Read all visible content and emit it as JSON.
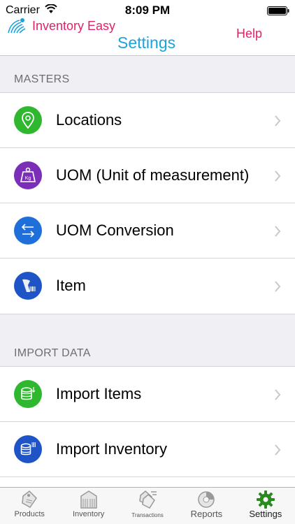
{
  "status_bar": {
    "carrier": "Carrier",
    "time": "8:09 PM"
  },
  "nav": {
    "app_name": "Inventory Easy",
    "title": "Settings",
    "help_label": "Help"
  },
  "sections": {
    "masters": {
      "header": "MASTERS",
      "items": [
        {
          "label": "Locations",
          "icon": "location-pin-icon",
          "color": "#2fb82f"
        },
        {
          "label": "UOM (Unit of measurement)",
          "icon": "kg-weight-icon",
          "color": "#7b2fb8"
        },
        {
          "label": "UOM Conversion",
          "icon": "conversion-arrows-icon",
          "color": "#1e6fd9"
        },
        {
          "label": "Item",
          "icon": "barcode-scanner-icon",
          "color": "#1e54c6"
        }
      ]
    },
    "import_data": {
      "header": "IMPORT DATA",
      "items": [
        {
          "label": "Import Items",
          "icon": "database-import-icon",
          "color": "#2fb82f"
        },
        {
          "label": "Import Inventory",
          "icon": "database-barcode-icon",
          "color": "#1e54c6"
        }
      ]
    }
  },
  "tab_bar": {
    "tabs": [
      {
        "label": "Products",
        "icon": "price-tag-icon"
      },
      {
        "label": "Inventory",
        "icon": "warehouse-icon"
      },
      {
        "label": "Transactions",
        "icon": "tags-list-icon"
      },
      {
        "label": "Reports",
        "icon": "pie-chart-icon"
      },
      {
        "label": "Settings",
        "icon": "gear-icon"
      }
    ],
    "active": "Settings",
    "active_color": "#2a8a1f"
  }
}
